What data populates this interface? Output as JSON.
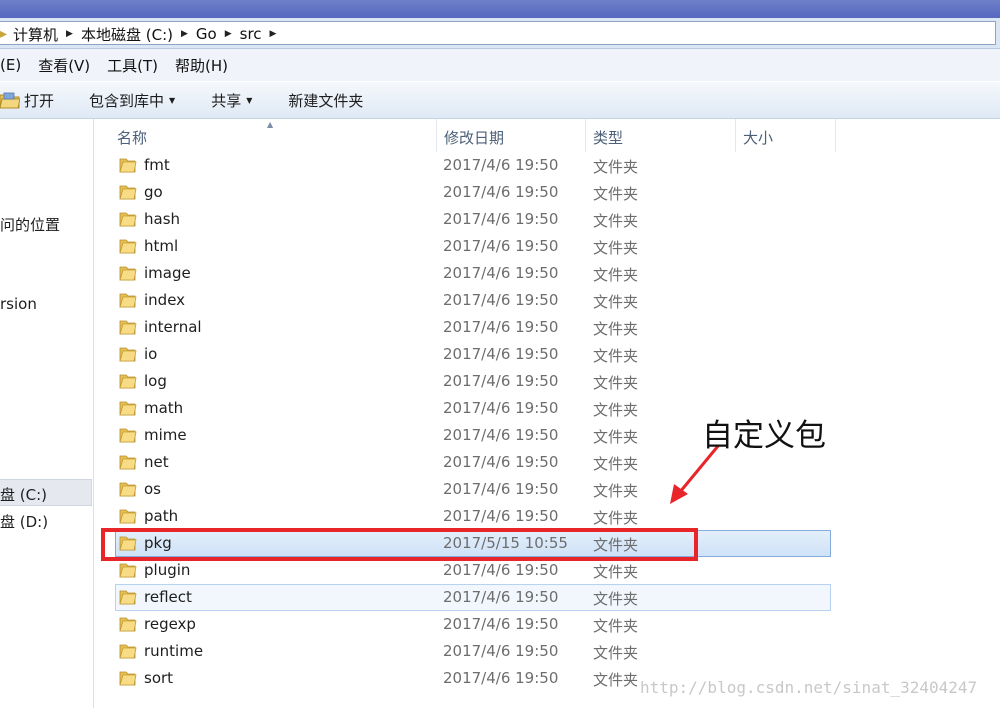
{
  "address_bar": {
    "breadcrumbs": [
      "计算机",
      "本地磁盘 (C:)",
      "Go",
      "src"
    ]
  },
  "menu": {
    "items": [
      "(E)",
      "查看(V)",
      "工具(T)",
      "帮助(H)"
    ]
  },
  "toolbar": {
    "open_label": "打开",
    "include_label": "包含到库中",
    "share_label": "共享",
    "new_folder_label": "新建文件夹"
  },
  "nav_pane": {
    "items": [
      "问的位置",
      "rsion",
      "盘 (C:)",
      "盘 (D:)"
    ]
  },
  "columns": {
    "name": "名称",
    "date": "修改日期",
    "type": "类型",
    "size": "大小"
  },
  "files": [
    {
      "name": "fmt",
      "date": "2017/4/6 19:50",
      "type": "文件夹"
    },
    {
      "name": "go",
      "date": "2017/4/6 19:50",
      "type": "文件夹"
    },
    {
      "name": "hash",
      "date": "2017/4/6 19:50",
      "type": "文件夹"
    },
    {
      "name": "html",
      "date": "2017/4/6 19:50",
      "type": "文件夹"
    },
    {
      "name": "image",
      "date": "2017/4/6 19:50",
      "type": "文件夹"
    },
    {
      "name": "index",
      "date": "2017/4/6 19:50",
      "type": "文件夹"
    },
    {
      "name": "internal",
      "date": "2017/4/6 19:50",
      "type": "文件夹"
    },
    {
      "name": "io",
      "date": "2017/4/6 19:50",
      "type": "文件夹"
    },
    {
      "name": "log",
      "date": "2017/4/6 19:50",
      "type": "文件夹"
    },
    {
      "name": "math",
      "date": "2017/4/6 19:50",
      "type": "文件夹"
    },
    {
      "name": "mime",
      "date": "2017/4/6 19:50",
      "type": "文件夹"
    },
    {
      "name": "net",
      "date": "2017/4/6 19:50",
      "type": "文件夹"
    },
    {
      "name": "os",
      "date": "2017/4/6 19:50",
      "type": "文件夹"
    },
    {
      "name": "path",
      "date": "2017/4/6 19:50",
      "type": "文件夹"
    },
    {
      "name": "pkg",
      "date": "2017/5/15 10:55",
      "type": "文件夹"
    },
    {
      "name": "plugin",
      "date": "2017/4/6 19:50",
      "type": "文件夹"
    },
    {
      "name": "reflect",
      "date": "2017/4/6 19:50",
      "type": "文件夹"
    },
    {
      "name": "regexp",
      "date": "2017/4/6 19:50",
      "type": "文件夹"
    },
    {
      "name": "runtime",
      "date": "2017/4/6 19:50",
      "type": "文件夹"
    },
    {
      "name": "sort",
      "date": "2017/4/6 19:50",
      "type": "文件夹"
    }
  ],
  "annotation": {
    "text": "自定义包",
    "highlight_color": "#e8262a"
  },
  "watermark": "http://blog.csdn.net/sinat_32404247",
  "icons": {
    "folder": "folder-icon",
    "open": "open-folder-icon",
    "breadcrumb_separator": "chevron-right-icon",
    "dropdown": "chevron-down-icon"
  }
}
